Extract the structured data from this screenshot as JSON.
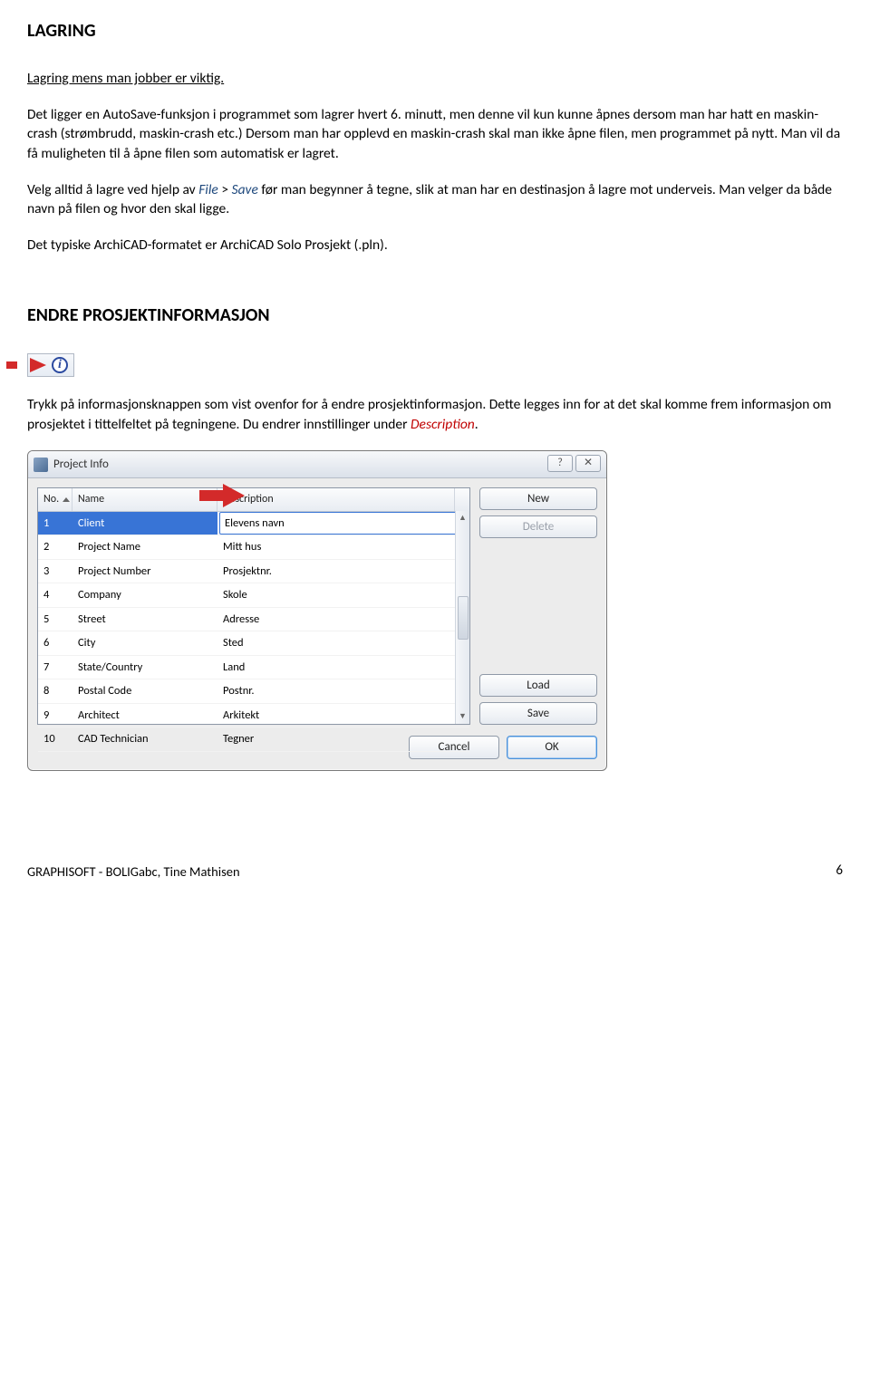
{
  "section1": {
    "heading": "LAGRING",
    "p1": "Lagring mens man jobber er viktig.",
    "p2a": "Det ligger en AutoSave-funksjon i programmet som lagrer hvert 6. minutt, men denne vil kun kunne åpnes dersom man har hatt en maskin-crash (strømbrudd, maskin-crash etc.) Dersom man har opplevd en maskin-crash skal man ikke åpne filen, men programmet på nytt. Man vil da få muligheten til å åpne filen som automatisk er lagret.",
    "p3_a": "Velg alltid å lagre ved hjelp av ",
    "p3_file": "File",
    "p3_gt": " > ",
    "p3_save": "Save",
    "p3_b": " før man begynner å tegne, slik at man har en destinasjon å lagre mot underveis. Man velger da både navn på filen og hvor den skal ligge.",
    "p4": "Det typiske ArchiCAD-formatet er ArchiCAD Solo Prosjekt (.pln)."
  },
  "section2": {
    "heading": "ENDRE PROSJEKTINFORMASJON",
    "p1_a": "Trykk på informasjonsknappen som vist ovenfor for å endre prosjektinformasjon. Dette legges inn for at det skal komme frem informasjon om prosjektet i tittelfeltet på tegningene. Du endrer innstillinger under ",
    "p1_desc": "Description",
    "p1_b": "."
  },
  "dialog": {
    "title": "Project Info",
    "columns": {
      "no": "No.",
      "name": "Name",
      "desc": "Description"
    },
    "rows": [
      {
        "no": "1",
        "name": "Client",
        "desc": "Elevens navn"
      },
      {
        "no": "2",
        "name": "Project Name",
        "desc": "Mitt hus"
      },
      {
        "no": "3",
        "name": "Project Number",
        "desc": "Prosjektnr."
      },
      {
        "no": "4",
        "name": "Company",
        "desc": "Skole"
      },
      {
        "no": "5",
        "name": "Street",
        "desc": "Adresse"
      },
      {
        "no": "6",
        "name": "City",
        "desc": "Sted"
      },
      {
        "no": "7",
        "name": "State/Country",
        "desc": "Land"
      },
      {
        "no": "8",
        "name": "Postal Code",
        "desc": "Postnr."
      },
      {
        "no": "9",
        "name": "Architect",
        "desc": "Arkitekt"
      },
      {
        "no": "10",
        "name": "CAD Technician",
        "desc": "Tegner"
      }
    ],
    "buttons": {
      "new": "New",
      "delete": "Delete",
      "load": "Load",
      "save": "Save",
      "cancel": "Cancel",
      "ok": "OK"
    }
  },
  "footer": {
    "left": "GRAPHISOFT - BOLIGabc, Tine Mathisen",
    "page": "6"
  }
}
